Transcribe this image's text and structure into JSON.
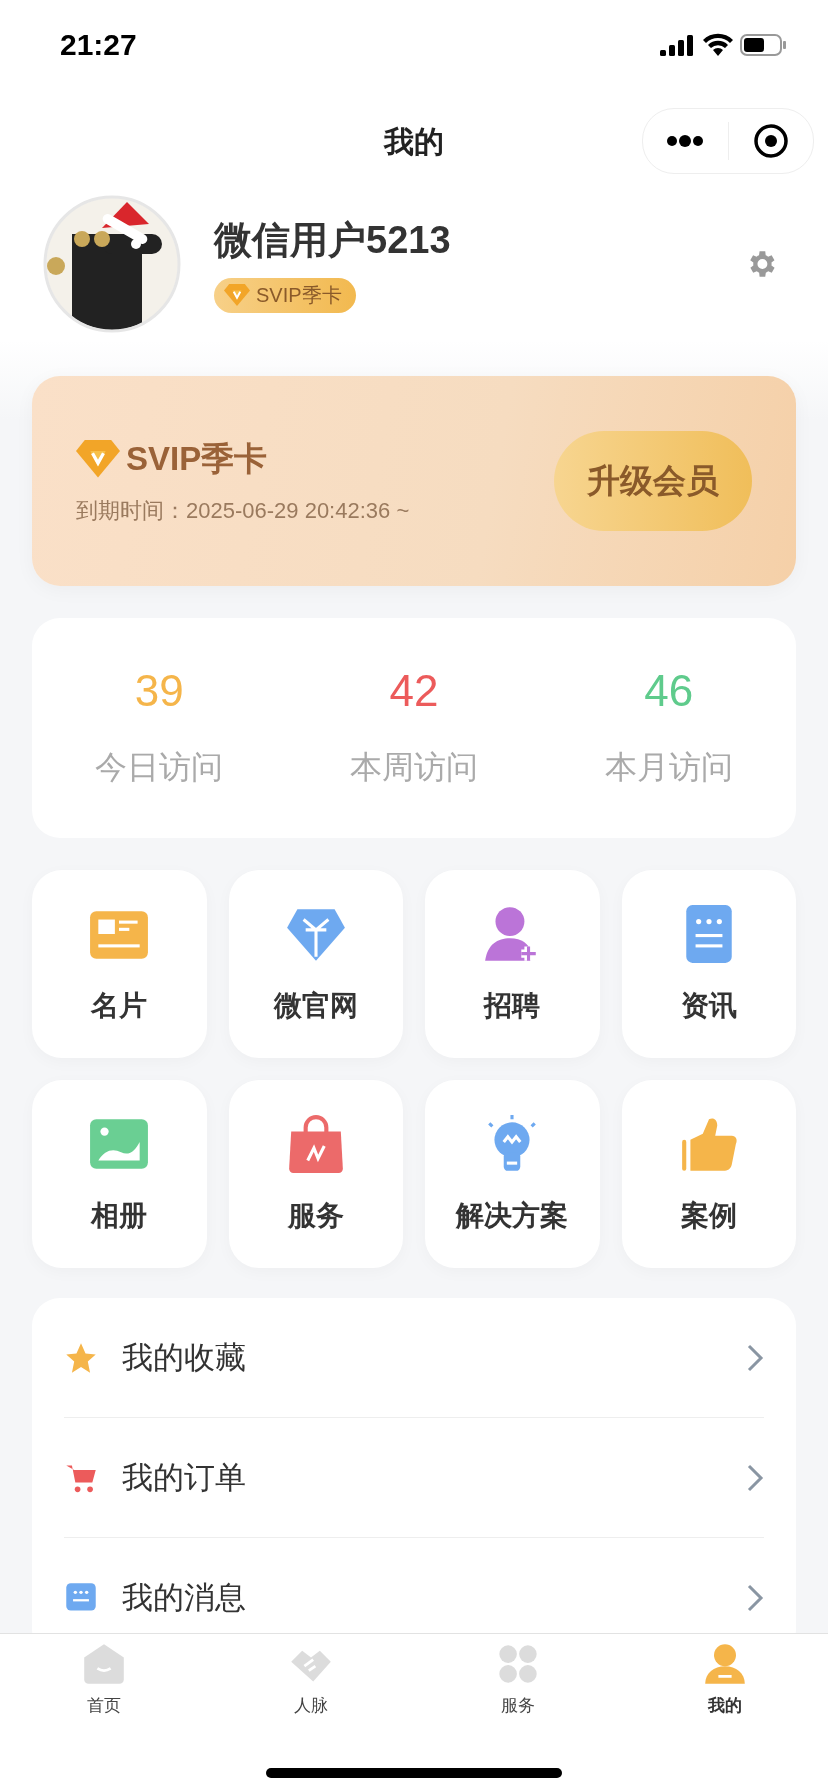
{
  "status_bar": {
    "time": "21:27"
  },
  "nav": {
    "title": "我的"
  },
  "profile": {
    "name": "微信用户5213",
    "badge": "SVIP季卡"
  },
  "vip_card": {
    "title": "SVIP季卡",
    "expiry": "到期时间：2025-06-29 20:42:36 ~",
    "button": "升级会员"
  },
  "stats": [
    {
      "value": "39",
      "label": "今日访问",
      "color": "#f5b54a"
    },
    {
      "value": "42",
      "label": "本周访问",
      "color": "#ec5b5b"
    },
    {
      "value": "46",
      "label": "本月访问",
      "color": "#5fcb8c"
    }
  ],
  "shortcuts": [
    {
      "label": "名片",
      "kind": "card"
    },
    {
      "label": "微官网",
      "kind": "diamond"
    },
    {
      "label": "招聘",
      "kind": "person"
    },
    {
      "label": "资讯",
      "kind": "news"
    },
    {
      "label": "相册",
      "kind": "photo"
    },
    {
      "label": "服务",
      "kind": "bag"
    },
    {
      "label": "解决方案",
      "kind": "bulb"
    },
    {
      "label": "案例",
      "kind": "thumb"
    }
  ],
  "menu": [
    {
      "label": "我的收藏",
      "kind": "star"
    },
    {
      "label": "我的订单",
      "kind": "cart"
    },
    {
      "label": "我的消息",
      "kind": "message"
    }
  ],
  "tab_bar": [
    {
      "label": "首页",
      "kind": "home",
      "selected": false
    },
    {
      "label": "人脉",
      "kind": "handshake",
      "selected": false
    },
    {
      "label": "服务",
      "kind": "grid",
      "selected": false
    },
    {
      "label": "我的",
      "kind": "person",
      "selected": true
    }
  ]
}
